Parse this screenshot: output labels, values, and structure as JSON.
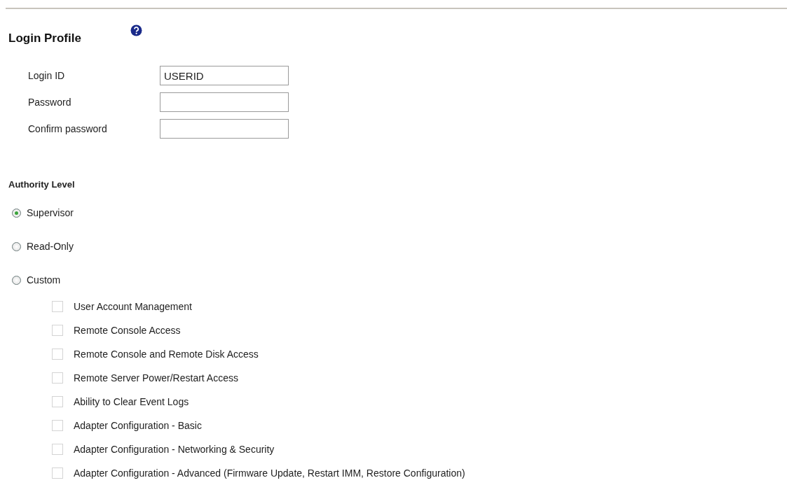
{
  "title": "Login Profile",
  "fields": [
    {
      "label": "Login ID",
      "value": "USERID"
    },
    {
      "label": "Password"
    },
    {
      "label": "Confirm password"
    }
  ],
  "authority": {
    "heading": "Authority Level",
    "options": [
      {
        "label": "Supervisor",
        "selected": true
      },
      {
        "label": "Read-Only",
        "selected": false
      },
      {
        "label": "Custom",
        "selected": false
      }
    ],
    "permissions": [
      {
        "label": "User Account Management",
        "checked": false,
        "disabled": true
      },
      {
        "label": "Remote Console Access",
        "checked": false,
        "disabled": true
      },
      {
        "label": "Remote Console and Remote Disk Access",
        "checked": false,
        "disabled": true
      },
      {
        "label": "Remote Server Power/Restart Access",
        "checked": false,
        "disabled": true
      },
      {
        "label": "Ability to Clear Event Logs",
        "checked": false,
        "disabled": true
      },
      {
        "label": "Adapter Configuration - Basic",
        "checked": false,
        "disabled": true
      },
      {
        "label": "Adapter Configuration - Networking & Security",
        "checked": false,
        "disabled": true
      },
      {
        "label": "Adapter Configuration - Advanced (Firmware Update, Restart IMM, Restore Configuration)",
        "checked": false,
        "disabled": true
      }
    ]
  }
}
